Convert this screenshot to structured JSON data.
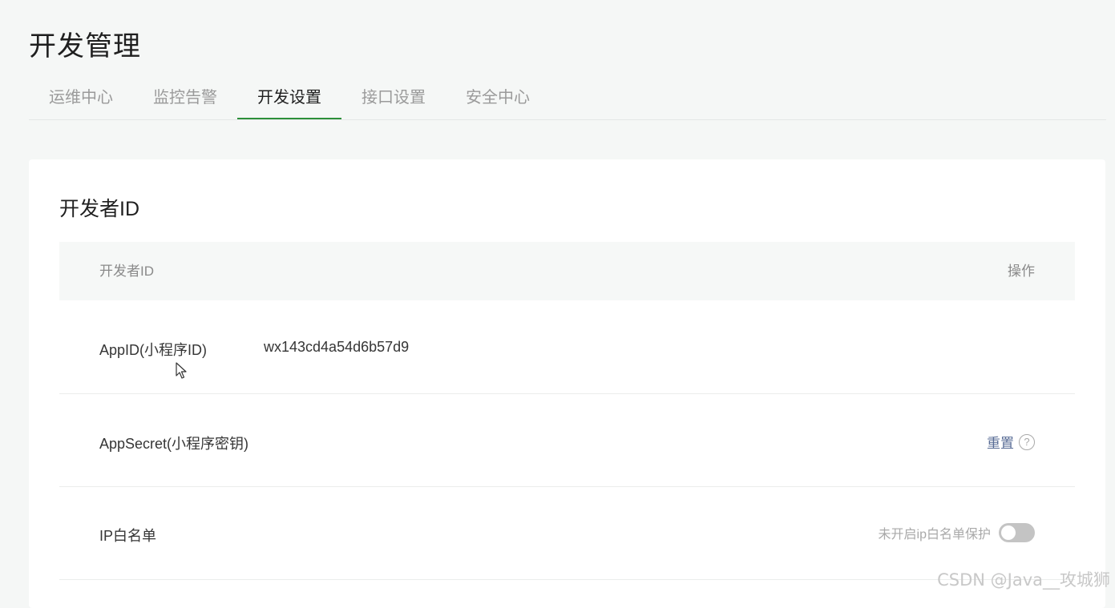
{
  "page": {
    "title": "开发管理"
  },
  "tabs": [
    {
      "label": "运维中心"
    },
    {
      "label": "监控告警"
    },
    {
      "label": "开发设置",
      "active": true
    },
    {
      "label": "接口设置"
    },
    {
      "label": "安全中心"
    }
  ],
  "section": {
    "title": "开发者ID",
    "table": {
      "columns": [
        "开发者ID",
        "操作"
      ],
      "rows": [
        {
          "label": "AppID(小程序ID)",
          "value": "wx143cd4a54d6b57d9"
        },
        {
          "label": "AppSecret(小程序密钥)",
          "action": "重置"
        },
        {
          "label": "IP白名单",
          "toggle_label": "未开启ip白名单保护",
          "toggle_on": false
        }
      ]
    }
  },
  "icons": {
    "help": "question-circle-icon",
    "cursor": "mouse-pointer-icon"
  },
  "colors": {
    "accent": "#2c8f3a",
    "link": "#576b95"
  },
  "watermark": "CSDN @Java__攻城狮"
}
